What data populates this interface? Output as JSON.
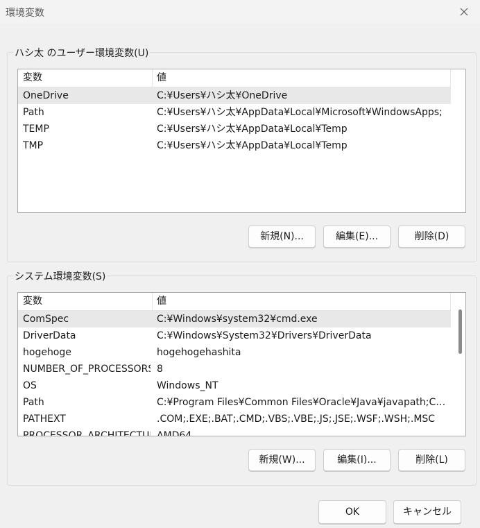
{
  "window": {
    "title": "環境変数"
  },
  "user_section": {
    "label": "ハシ太 のユーザー環境変数(U)",
    "columns": [
      "変数",
      "値"
    ],
    "rows": [
      {
        "name": "OneDrive",
        "value": "C:¥Users¥ハシ太¥OneDrive"
      },
      {
        "name": "Path",
        "value": "C:¥Users¥ハシ太¥AppData¥Local¥Microsoft¥WindowsApps;"
      },
      {
        "name": "TEMP",
        "value": "C:¥Users¥ハシ太¥AppData¥Local¥Temp"
      },
      {
        "name": "TMP",
        "value": "C:¥Users¥ハシ太¥AppData¥Local¥Temp"
      }
    ],
    "buttons": {
      "new": "新規(N)...",
      "edit": "編集(E)...",
      "delete": "削除(D)"
    }
  },
  "system_section": {
    "label": "システム環境変数(S)",
    "columns": [
      "変数",
      "値"
    ],
    "rows": [
      {
        "name": "ComSpec",
        "value": "C:¥Windows¥system32¥cmd.exe"
      },
      {
        "name": "DriverData",
        "value": "C:¥Windows¥System32¥Drivers¥DriverData"
      },
      {
        "name": "hogehoge",
        "value": "hogehogehashita"
      },
      {
        "name": "NUMBER_OF_PROCESSORS",
        "value": "8"
      },
      {
        "name": "OS",
        "value": "Windows_NT"
      },
      {
        "name": "Path",
        "value": "C:¥Program Files¥Common Files¥Oracle¥Java¥javapath;C:¥Wi..."
      },
      {
        "name": "PATHEXT",
        "value": ".COM;.EXE;.BAT;.CMD;.VBS;.VBE;.JS;.JSE;.WSF;.WSH;.MSC"
      },
      {
        "name": "PROCESSOR_ARCHITECTURE",
        "value": "AMD64"
      }
    ],
    "buttons": {
      "new": "新規(W)...",
      "edit": "編集(I)...",
      "delete": "削除(L)"
    }
  },
  "dialog_buttons": {
    "ok": "OK",
    "cancel": "キャンセル"
  },
  "icons": {
    "close": "close-icon"
  }
}
